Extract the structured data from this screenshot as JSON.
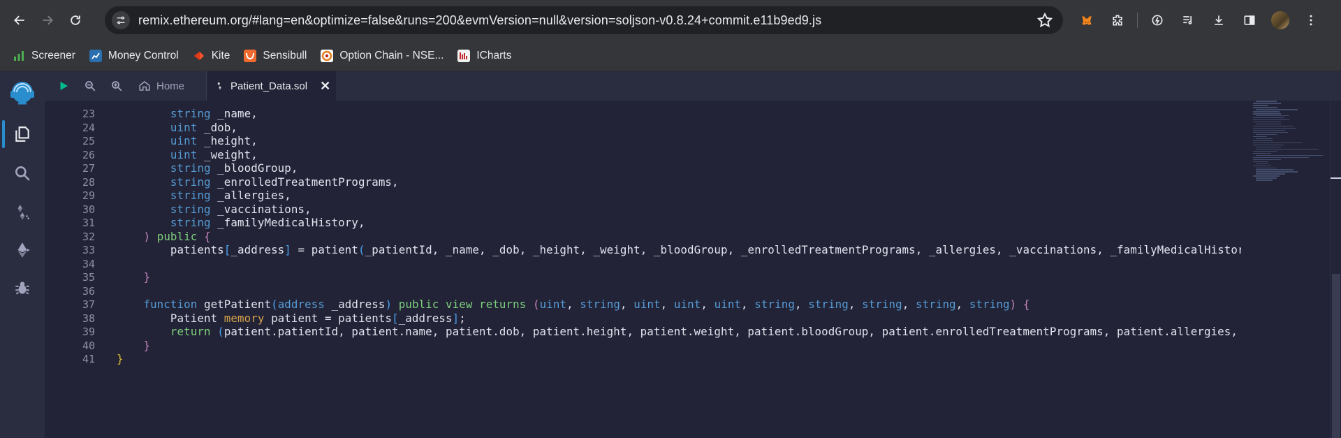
{
  "browser": {
    "url": "remix.ethereum.org/#lang=en&optimize=false&runs=200&evmVersion=null&version=soljson-v0.8.24+commit.e11b9ed9.js",
    "bookmarks": [
      {
        "label": "Screener",
        "icon": "bar-chart-icon",
        "color": "#4caf50"
      },
      {
        "label": "Money Control",
        "icon": "moneycontrol-icon",
        "color": "#2a6fb0"
      },
      {
        "label": "Kite",
        "icon": "kite-icon",
        "color": "#f5512a"
      },
      {
        "label": "Sensibull",
        "icon": "sensibull-icon",
        "color": "#f06a2f"
      },
      {
        "label": "Option Chain - NSE...",
        "icon": "nse-icon",
        "color": "#e57c1f"
      },
      {
        "label": "ICharts",
        "icon": "icharts-icon",
        "color": "#e6e6e6"
      }
    ]
  },
  "remix": {
    "tabs": {
      "home": "Home",
      "file": "Patient_Data.sol"
    },
    "accent": "#2a8dce"
  },
  "code": {
    "line_numbers": [
      "23",
      "24",
      "25",
      "26",
      "27",
      "28",
      "29",
      "30",
      "31",
      "32",
      "33",
      "34",
      "35",
      "36",
      "37",
      "38",
      "39",
      "40",
      "41"
    ],
    "lines": [
      {
        "indent": "        ",
        "tokens": [
          [
            "kw",
            "string"
          ],
          [
            "t",
            " _name,"
          ]
        ]
      },
      {
        "indent": "        ",
        "tokens": [
          [
            "kw",
            "uint"
          ],
          [
            "t",
            " _dob,"
          ]
        ]
      },
      {
        "indent": "        ",
        "tokens": [
          [
            "kw",
            "uint"
          ],
          [
            "t",
            " _height,"
          ]
        ]
      },
      {
        "indent": "        ",
        "tokens": [
          [
            "kw",
            "uint"
          ],
          [
            "t",
            " _weight,"
          ]
        ]
      },
      {
        "indent": "        ",
        "tokens": [
          [
            "kw",
            "string"
          ],
          [
            "t",
            " _bloodGroup,"
          ]
        ]
      },
      {
        "indent": "        ",
        "tokens": [
          [
            "kw",
            "string"
          ],
          [
            "t",
            " _enrolledTreatmentPrograms,"
          ]
        ]
      },
      {
        "indent": "        ",
        "tokens": [
          [
            "kw",
            "string"
          ],
          [
            "t",
            " _allergies,"
          ]
        ]
      },
      {
        "indent": "        ",
        "tokens": [
          [
            "kw",
            "string"
          ],
          [
            "t",
            " _vaccinations,"
          ]
        ]
      },
      {
        "indent": "        ",
        "tokens": [
          [
            "kw",
            "string"
          ],
          [
            "t",
            " _familyMedicalHistory,"
          ]
        ]
      },
      {
        "indent": "    ",
        "tokens": [
          [
            "br2",
            ")"
          ],
          [
            "t",
            " "
          ],
          [
            "kw2",
            "public"
          ],
          [
            "t",
            " "
          ],
          [
            "br2",
            "{"
          ]
        ]
      },
      {
        "indent": "        ",
        "tokens": [
          [
            "t",
            "patients"
          ],
          [
            "br3",
            "["
          ],
          [
            "t",
            "_address"
          ],
          [
            "br3",
            "]"
          ],
          [
            "t",
            " = patient"
          ],
          [
            "br3",
            "("
          ],
          [
            "t",
            "_patientId, _name, _dob, _height, _weight, _bloodGroup, _enrolledTreatmentPrograms, _allergies, _vaccinations, _familyMedicalHistor"
          ]
        ]
      },
      {
        "indent": "",
        "tokens": []
      },
      {
        "indent": "    ",
        "tokens": [
          [
            "br2",
            "}"
          ]
        ]
      },
      {
        "indent": "",
        "tokens": []
      },
      {
        "indent": "    ",
        "tokens": [
          [
            "kw",
            "function"
          ],
          [
            "t",
            " getPatient"
          ],
          [
            "br3",
            "("
          ],
          [
            "kw",
            "address"
          ],
          [
            "t",
            " _address"
          ],
          [
            "br3",
            ")"
          ],
          [
            "t",
            " "
          ],
          [
            "kw2",
            "public"
          ],
          [
            "t",
            " "
          ],
          [
            "kw2",
            "view"
          ],
          [
            "t",
            " "
          ],
          [
            "kw2",
            "returns"
          ],
          [
            "t",
            " "
          ],
          [
            "br2",
            "("
          ],
          [
            "kw",
            "uint"
          ],
          [
            "t",
            ", "
          ],
          [
            "kw",
            "string"
          ],
          [
            "t",
            ", "
          ],
          [
            "kw",
            "uint"
          ],
          [
            "t",
            ", "
          ],
          [
            "kw",
            "uint"
          ],
          [
            "t",
            ", "
          ],
          [
            "kw",
            "uint"
          ],
          [
            "t",
            ", "
          ],
          [
            "kw",
            "string"
          ],
          [
            "t",
            ", "
          ],
          [
            "kw",
            "string"
          ],
          [
            "t",
            ", "
          ],
          [
            "kw",
            "string"
          ],
          [
            "t",
            ", "
          ],
          [
            "kw",
            "string"
          ],
          [
            "t",
            ", "
          ],
          [
            "kw",
            "string"
          ],
          [
            "br2",
            ")"
          ],
          [
            "t",
            " "
          ],
          [
            "br2",
            "{"
          ]
        ]
      },
      {
        "indent": "        ",
        "tokens": [
          [
            "t",
            "Patient "
          ],
          [
            "mem",
            "memory"
          ],
          [
            "t",
            " patient = patients"
          ],
          [
            "br3",
            "["
          ],
          [
            "t",
            "_address"
          ],
          [
            "br3",
            "]"
          ],
          [
            "t",
            ";"
          ]
        ]
      },
      {
        "indent": "        ",
        "tokens": [
          [
            "kw2",
            "return"
          ],
          [
            "t",
            " "
          ],
          [
            "br3",
            "("
          ],
          [
            "t",
            "patient.patientId, patient.name, patient.dob, patient.height, patient.weight, patient.bloodGroup, patient.enrolledTreatmentPrograms, patient.allergies,"
          ]
        ]
      },
      {
        "indent": "    ",
        "tokens": [
          [
            "br2",
            "}"
          ]
        ]
      },
      {
        "indent": "",
        "tokens": [
          [
            "br1",
            "}"
          ]
        ]
      }
    ]
  }
}
